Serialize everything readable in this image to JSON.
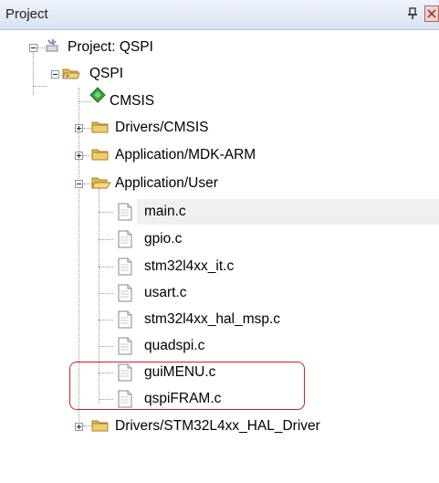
{
  "panel": {
    "title": "Project",
    "pin_icon": "pin-icon",
    "close_icon": "close-icon"
  },
  "tree": {
    "root": {
      "label": "Project: QSPI",
      "icon": "project-icon"
    },
    "target": {
      "label": "QSPI",
      "icon": "target-folder-icon"
    },
    "groups": [
      {
        "label": "CMSIS",
        "icon": "component-diamond-icon",
        "expander": "none"
      },
      {
        "label": "Drivers/CMSIS",
        "icon": "folder-closed-icon",
        "expander": "plus"
      },
      {
        "label": "Application/MDK-ARM",
        "icon": "folder-closed-icon",
        "expander": "plus"
      },
      {
        "label": "Application/User",
        "icon": "folder-open-icon",
        "expander": "minus"
      },
      {
        "label": "Drivers/STM32L4xx_HAL_Driver",
        "icon": "folder-closed-icon",
        "expander": "plus"
      }
    ],
    "user_files": [
      {
        "label": "main.c",
        "icon": "c-file-icon"
      },
      {
        "label": "gpio.c",
        "icon": "c-file-icon"
      },
      {
        "label": "stm32l4xx_it.c",
        "icon": "c-file-icon"
      },
      {
        "label": "usart.c",
        "icon": "c-file-icon"
      },
      {
        "label": "stm32l4xx_hal_msp.c",
        "icon": "c-file-icon"
      },
      {
        "label": "quadspi.c",
        "icon": "c-file-icon"
      },
      {
        "label": "guiMENU.c",
        "icon": "c-file-icon"
      },
      {
        "label": "qspiFRAM.c",
        "icon": "c-file-icon"
      }
    ]
  },
  "colors": {
    "highlight": "#d21e1e",
    "folder": "#e6b94a",
    "component": "#2fa43a",
    "header": "#dde6f2"
  }
}
